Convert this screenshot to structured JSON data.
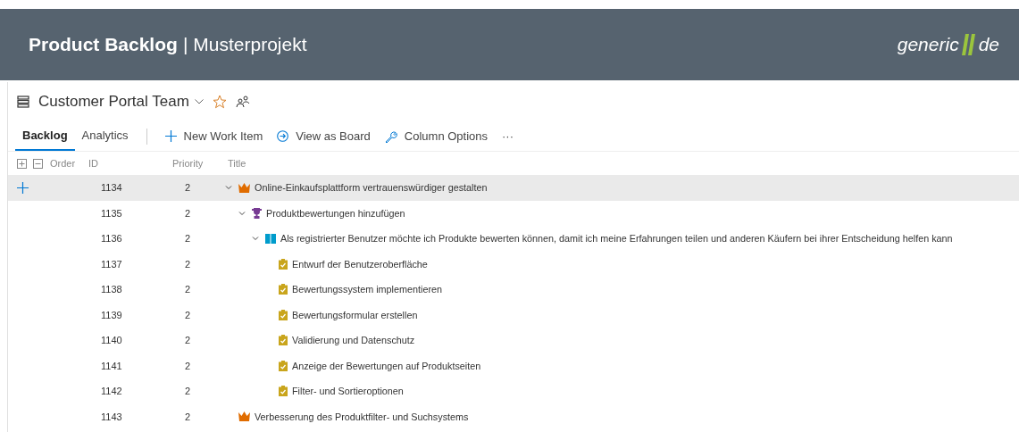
{
  "header": {
    "title": "Product Backlog",
    "separator": "|",
    "project": "Musterprojekt",
    "logo": {
      "left": "generic",
      "right": "de"
    }
  },
  "team": {
    "name": "Customer Portal Team",
    "favorite": false
  },
  "tabs": [
    {
      "label": "Backlog",
      "selected": true
    },
    {
      "label": "Analytics",
      "selected": false
    }
  ],
  "toolbar": [
    {
      "kind": "add",
      "label": "New Work Item"
    },
    {
      "kind": "board",
      "label": "View as Board"
    },
    {
      "kind": "columns",
      "label": "Column Options"
    },
    {
      "kind": "more",
      "label": "···"
    }
  ],
  "table": {
    "columns": [
      "Order",
      "ID",
      "Priority",
      "Title"
    ],
    "rows": [
      {
        "id": "1134",
        "priority": "2",
        "title": "Online-Einkaufsplattform vertrauenswürdiger gestalten",
        "kind": "epic",
        "selected": true,
        "expanded": true,
        "children": [
          {
            "id": "1135",
            "priority": "2",
            "title": "Produktbewertungen hinzufügen",
            "kind": "feature",
            "selected": false,
            "expanded": true,
            "children": [
              {
                "id": "1136",
                "priority": "2",
                "title": "Als registrierter Benutzer möchte ich Produkte bewerten können, damit ich meine Erfahrungen teilen und anderen Käufern bei ihrer Entscheidung helfen kann",
                "kind": "story",
                "selected": false,
                "expanded": true,
                "children": [
                  {
                    "id": "1137",
                    "priority": "2",
                    "title": "Entwurf der Benutzeroberfläche",
                    "kind": "task",
                    "selected": false
                  },
                  {
                    "id": "1138",
                    "priority": "2",
                    "title": "Bewertungssystem implementieren",
                    "kind": "task",
                    "selected": false
                  },
                  {
                    "id": "1139",
                    "priority": "2",
                    "title": "Bewertungsformular erstellen",
                    "kind": "task",
                    "selected": false
                  },
                  {
                    "id": "1140",
                    "priority": "2",
                    "title": "Validierung und Datenschutz",
                    "kind": "task",
                    "selected": false
                  },
                  {
                    "id": "1141",
                    "priority": "2",
                    "title": "Anzeige der Bewertungen auf Produktseiten",
                    "kind": "task",
                    "selected": false
                  },
                  {
                    "id": "1142",
                    "priority": "2",
                    "title": "Filter- und Sortieroptionen",
                    "kind": "task",
                    "selected": false
                  }
                ]
              }
            ]
          }
        ]
      },
      {
        "id": "1143",
        "priority": "2",
        "title": "Verbesserung des Produktfilter- und Suchsystems",
        "kind": "epic",
        "selected": false
      }
    ]
  }
}
